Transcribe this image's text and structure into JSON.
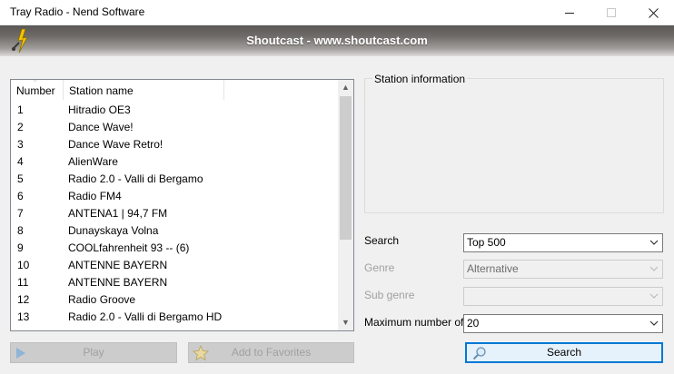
{
  "window": {
    "title": "Tray Radio - Nend Software"
  },
  "banner": {
    "text": "Shoutcast - www.shoutcast.com"
  },
  "station_list": {
    "columns": {
      "number": "Number",
      "name": "Station name"
    },
    "rows": [
      {
        "number": "1",
        "name": "Hitradio OE3"
      },
      {
        "number": "2",
        "name": "Dance Wave!"
      },
      {
        "number": "3",
        "name": "Dance Wave Retro!"
      },
      {
        "number": "4",
        "name": "AlienWare"
      },
      {
        "number": "5",
        "name": "Radio 2.0 - Valli di Bergamo"
      },
      {
        "number": "6",
        "name": "Radio FM4"
      },
      {
        "number": "7",
        "name": "ANTENA1 | 94,7 FM"
      },
      {
        "number": "8",
        "name": "Dunayskaya Volna"
      },
      {
        "number": "9",
        "name": "COOLfahrenheit 93 -- (6)"
      },
      {
        "number": "10",
        "name": "ANTENNE BAYERN"
      },
      {
        "number": "11",
        "name": "ANTENNE BAYERN"
      },
      {
        "number": "12",
        "name": "Radio Groove"
      },
      {
        "number": "13",
        "name": "Radio 2.0 - Valli di Bergamo HD"
      }
    ]
  },
  "buttons": {
    "play": "Play",
    "add_favorites": "Add to Favorites",
    "search": "Search"
  },
  "station_info": {
    "legend": "Station information"
  },
  "form": {
    "search_label": "Search",
    "search_value": "Top 500",
    "genre_label": "Genre",
    "genre_value": "Alternative",
    "subgenre_label": "Sub genre",
    "subgenre_value": "",
    "max_label": "Maximum number of",
    "max_value": "20"
  },
  "colors": {
    "accent": "#0078d7",
    "disabled_button": "#cccccc"
  }
}
